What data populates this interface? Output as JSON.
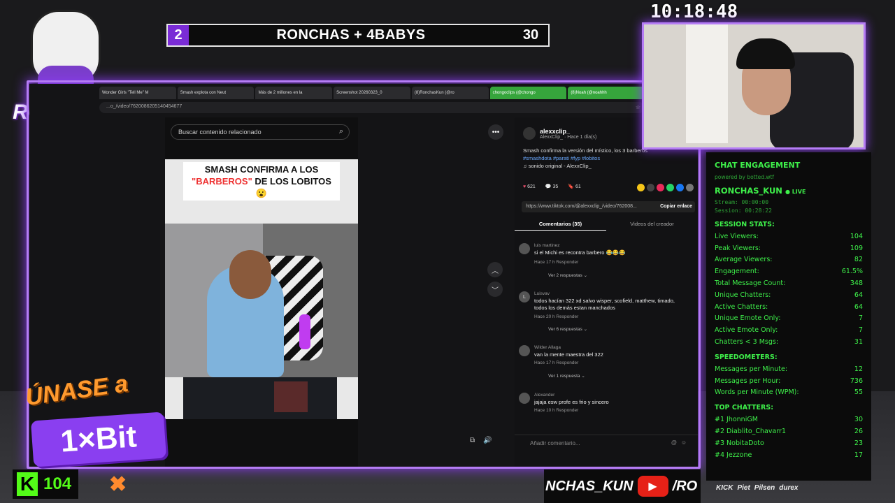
{
  "clock": "10:18:48",
  "scoreboard": {
    "left": "2",
    "title": "RONCHAS + 4BABYS",
    "right": "30"
  },
  "logo_text": "RONCHAS",
  "browser": {
    "tabs": [
      "Wonder Girls \"Tell Me\" M",
      "Smash explota con Neut",
      "Más de 2 millones en la",
      "Screenshot 20260323_0",
      "(8)RonchasKun (@ro",
      "chongoclips (@chongo",
      "(8)Noah (@noahhh"
    ],
    "url": "...o_/video/7620086205140454677",
    "search_placeholder": "Buscar contenido relacionado",
    "video_banner_line1": "SMASH CONFIRMA A LOS",
    "video_banner_hl": "\"BARBEROS\"",
    "video_banner_line2": "DE LOS LOBITOS😮",
    "author": {
      "name": "alexxclip_",
      "meta": "AlexxClip_ · Hace 1 día(s)"
    },
    "description": "Smash confirma la versión del místico, los 3 barberos",
    "hashtags": "#smashdota #parati #fyp #lobitos",
    "sound": "♫  sonido original - AlexxClip_",
    "likes": "621",
    "comments_count": "35",
    "saves": "61",
    "link": "https://www.tiktok.com/@alexxclip_/video/762008...",
    "copy_link": "Copiar enlace",
    "tab_comments": "Comentarios (35)",
    "tab_creator": "Videos del creador",
    "comments": [
      {
        "initial": "",
        "user": "luis martinez",
        "text": "si el Michi es recontra barbero 😂😂😂",
        "time": "Hace 17 h   Responder",
        "replies": "Ver 2 respuestas ⌄"
      },
      {
        "initial": "L",
        "user": "Luisvav",
        "text": "todos hacían 322 xd salvo wisper, scofield, matthew, timado, todos los demás estan manchados",
        "time": "Hace 20 h   Responder",
        "replies": "Ver 6 respuestas ⌄"
      },
      {
        "initial": "",
        "user": "Wilder Allaga",
        "text": "van la mente maestra del 322",
        "time": "Hace 17 h   Responder",
        "replies": "Ver 1 respuesta ⌄"
      },
      {
        "initial": "",
        "user": "Alexander",
        "text": "jajaja esw profe es frio y sincero",
        "time": "Hace 10 h   Responder",
        "replies": ""
      }
    ],
    "add_comment": "Añadir comentario..."
  },
  "stats": {
    "title": "CHAT ENGAGEMENT",
    "powered": "powered by botted.wtf",
    "user": "RONCHAS_KUN",
    "live": "● LIVE",
    "stream": "Stream: 00:00:00",
    "session": "Session: 00:28:22",
    "session_title": "SESSION STATS:",
    "rows": [
      {
        "label": "Live Viewers:",
        "value": "104"
      },
      {
        "label": "Peak Viewers:",
        "value": "109"
      },
      {
        "label": "Average Viewers:",
        "value": "82"
      },
      {
        "label": "Engagement:",
        "value": "61.5%"
      },
      {
        "label": "Total Message Count:",
        "value": "348"
      },
      {
        "label": "Unique Chatters:",
        "value": "64"
      },
      {
        "label": "Active Chatters:",
        "value": "64"
      },
      {
        "label": "Unique Emote Only:",
        "value": "7"
      },
      {
        "label": "Active Emote Only:",
        "value": "7"
      },
      {
        "label": "Chatters < 3 Msgs:",
        "value": "31"
      }
    ],
    "speed_title": "SPEEDOMETERS:",
    "speed": [
      {
        "label": "Messages per Minute:",
        "value": "12"
      },
      {
        "label": "Messages per Hour:",
        "value": "736"
      },
      {
        "label": "Words per Minute (WPM):",
        "value": "55"
      }
    ],
    "top_title": "TOP CHATTERS:",
    "top": [
      {
        "label": "#1 JhonniGM",
        "value": "30"
      },
      {
        "label": "#2 Diablito_Chavarr1",
        "value": "26"
      },
      {
        "label": "#3 NobitaDoto",
        "value": "23"
      },
      {
        "label": "#4 Jezzone",
        "value": "17"
      }
    ]
  },
  "promo": {
    "line1": "ÚNASE a",
    "brand": "1×Bit"
  },
  "kick": {
    "letter": "K",
    "viewers": "104"
  },
  "bottom": {
    "handle": "NCHAS_KUN",
    "handle2": "/RO"
  },
  "sponsors": [
    "KICK",
    "Piet",
    "Pilsen",
    "durex"
  ]
}
